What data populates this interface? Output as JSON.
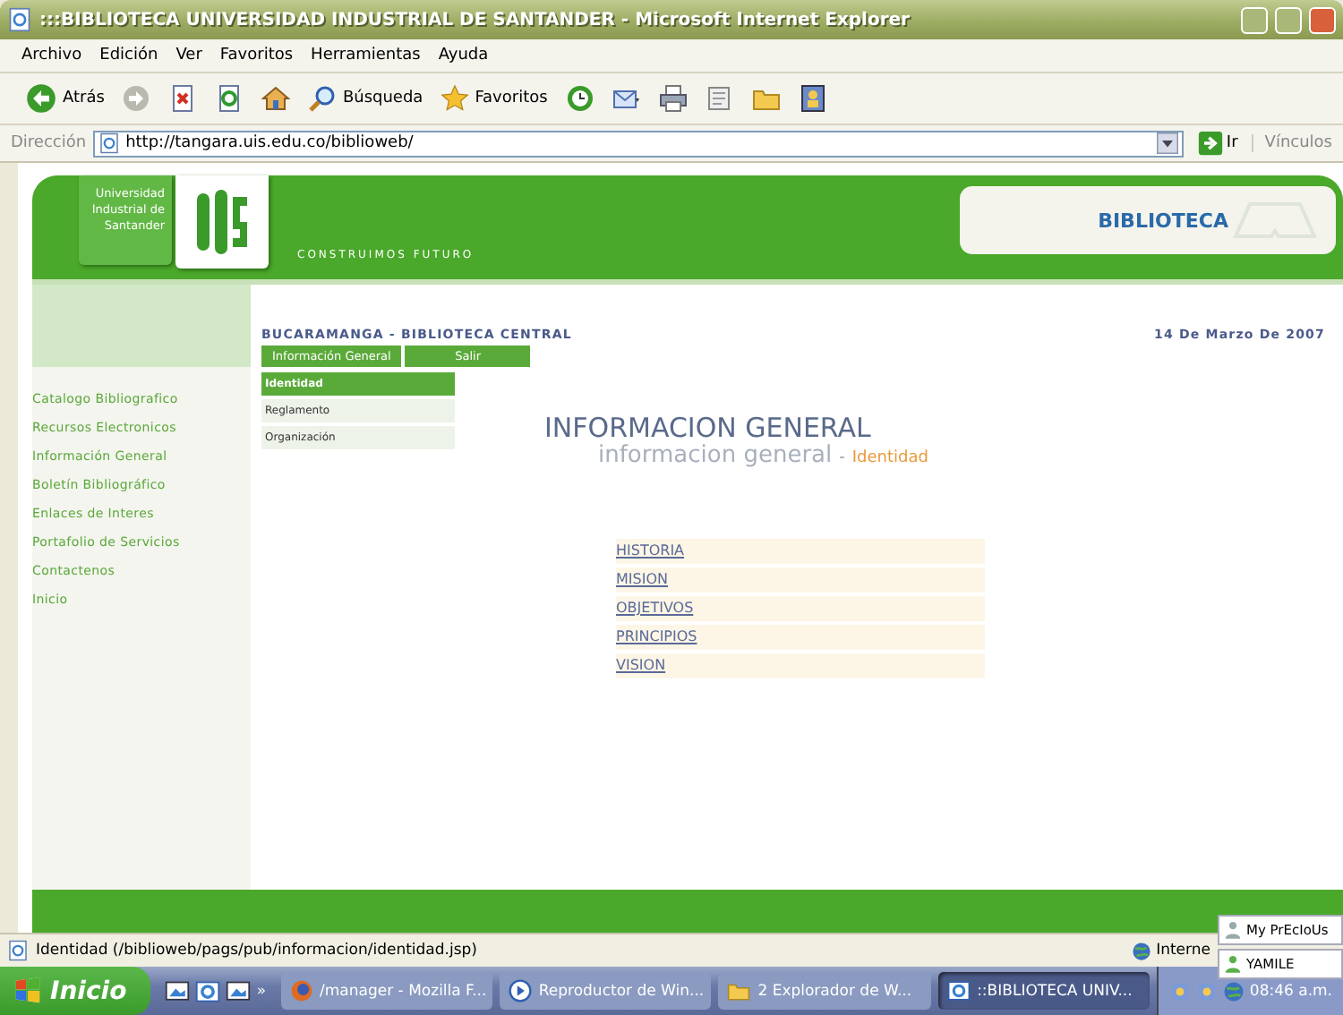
{
  "window": {
    "title": ":::BIBLIOTECA UNIVERSIDAD INDUSTRIAL DE SANTANDER - Microsoft Internet Explorer"
  },
  "menu_bar": [
    "Archivo",
    "Edición",
    "Ver",
    "Favoritos",
    "Herramientas",
    "Ayuda"
  ],
  "toolbar": [
    {
      "kind": "back",
      "label": "Atrás"
    },
    {
      "kind": "forward"
    },
    {
      "kind": "stop"
    },
    {
      "kind": "refresh"
    },
    {
      "kind": "home"
    },
    {
      "kind": "search",
      "label": "Búsqueda"
    },
    {
      "kind": "favorites",
      "label": "Favoritos"
    },
    {
      "kind": "history"
    },
    {
      "kind": "mail"
    },
    {
      "kind": "print"
    },
    {
      "kind": "edit"
    },
    {
      "kind": "folder"
    },
    {
      "kind": "messenger"
    }
  ],
  "address_bar": {
    "label": "Dirección",
    "url": "http://tangara.uis.edu.co/biblioweb/",
    "go": "Ir",
    "links": "Vínculos"
  },
  "page": {
    "logo_text": "Universidad Industrial de Santander",
    "slogan": "CONSTRUIMOS FUTURO",
    "banner": "BIBLIOTECA",
    "location": "BUCARAMANGA - BIBLIOTECA CENTRAL",
    "date": "14 De Marzo De 2007",
    "tabs": [
      "Información General",
      "Salir"
    ],
    "submenu": [
      {
        "label": "Identidad",
        "selected": true
      },
      {
        "label": "Reglamento",
        "selected": false
      },
      {
        "label": "Organización",
        "selected": false
      }
    ],
    "sidebar": [
      "Catalogo Bibliografico",
      "Recursos Electronicos",
      "Información General",
      "Boletín Bibliográfico",
      "Enlaces de Interes",
      "Portafolio de Servicios",
      "Contactenos",
      "Inicio"
    ],
    "heading": "INFORMACION GENERAL",
    "subheading": "informacion general",
    "separator": "-",
    "section": "Identidad",
    "links": [
      "HISTORIA",
      "MISION",
      "OBJETIVOS",
      "PRINCIPIOS",
      "VISION"
    ]
  },
  "status_bar": {
    "text": "Identidad (/biblioweb/pags/pub/informacion/identidad.jsp)",
    "zone": "Interne"
  },
  "contacts": [
    "My PrEcIoUs",
    "YAMILE"
  ],
  "taskbar": {
    "start": "Inicio",
    "quick_launch_more": "»",
    "tasks": [
      {
        "kind": "firefox",
        "label": "/manager - Mozilla F...",
        "selected": false
      },
      {
        "kind": "media",
        "label": "Reproductor de Win...",
        "selected": false
      },
      {
        "kind": "folder",
        "label": "2 Explorador de W...",
        "selected": false
      },
      {
        "kind": "ie",
        "label": "::BIBLIOTECA UNIV...",
        "selected": true
      }
    ],
    "clock": "08:46 a.m."
  }
}
